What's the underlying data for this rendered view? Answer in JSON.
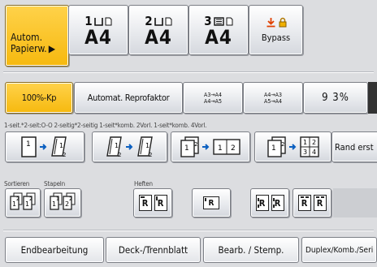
{
  "trays": {
    "auto_label_line1": "Autom.",
    "auto_label_line2": "Papierw.",
    "tray1_num": "1",
    "tray1_size": "A4",
    "tray2_num": "2",
    "tray2_size": "A4",
    "tray3_num": "3",
    "tray3_size": "A4",
    "bypass_label": "Bypass"
  },
  "reproduction": {
    "full_size": "100%-Kp",
    "auto_reduce": "Automat. Reprofaktor",
    "preset1_line1": "A3→A4",
    "preset1_line2": "A4→A5",
    "preset2_line1": "A4→A3",
    "preset2_line2": "A5→A4",
    "zoom_value": "9 3%"
  },
  "duplex_labels": "1-seit.*2-seit:O-O   2-seitig*2-seitig   1-seit*komb. 2Vorl. 1-seit*komb. 4Vorl.",
  "duplex": {
    "combine2_a": "1",
    "combine2_b": "2",
    "combine4_a": "1",
    "combine4_b": "2",
    "combine4_c": "3",
    "combine4_d": "4",
    "src1": "1",
    "src2": "2",
    "dst2": "2",
    "rand": "Rand erst"
  },
  "finishing_labels": {
    "sort": "Sortieren",
    "stack": "Stapeln",
    "staple": "Heften"
  },
  "staple_glyph": "R",
  "tabs": [
    "Endbearbeitung",
    "Deck-/Trennblatt",
    "Bearb. / Stemp.",
    "Duplex/Komb./Seri"
  ],
  "colors": {
    "selected": "#f6b90f",
    "background": "#dcdde0",
    "bypass_icon": "#e04000"
  }
}
